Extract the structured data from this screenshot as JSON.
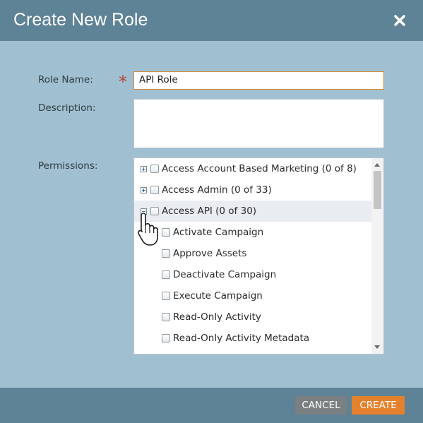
{
  "dialog": {
    "title": "Create New Role"
  },
  "form": {
    "role_name_label": "Role Name:",
    "role_name_required_marker": "*",
    "role_name_value": "API Role",
    "description_label": "Description:",
    "description_value": "",
    "permissions_label": "Permissions:"
  },
  "permissions": {
    "groups": [
      {
        "label": "Access Account Based Marketing (0 of 8)",
        "expanded": false,
        "checked": false
      },
      {
        "label": "Access Admin (0 of 33)",
        "expanded": false,
        "checked": false
      },
      {
        "label": "Access API (0 of 30)",
        "expanded": true,
        "checked": false
      }
    ],
    "api_children": [
      {
        "label": "Activate Campaign",
        "checked": false
      },
      {
        "label": "Approve Assets",
        "checked": false
      },
      {
        "label": "Deactivate Campaign",
        "checked": false
      },
      {
        "label": "Execute Campaign",
        "checked": false
      },
      {
        "label": "Read-Only Activity",
        "checked": false
      },
      {
        "label": "Read-Only Activity Metadata",
        "checked": false
      }
    ]
  },
  "footer": {
    "cancel_label": "CANCEL",
    "create_label": "CREATE"
  },
  "colors": {
    "header": "#5e8296",
    "body": "#a0c0d1",
    "required": "#b5443a",
    "focus_border": "#d08a3a",
    "cancel": "#7a7f82",
    "create": "#e5812c"
  },
  "icons": {
    "close": "close-icon",
    "expand": "plus-box-icon",
    "collapse": "minus-box-icon",
    "cursor": "hand-pointer-icon"
  }
}
